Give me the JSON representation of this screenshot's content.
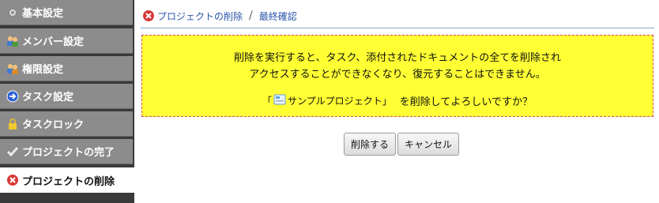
{
  "sidebar": {
    "items": [
      {
        "label": "基本設定",
        "icon": "settings-icon"
      },
      {
        "label": "メンバー設定",
        "icon": "members-icon"
      },
      {
        "label": "権限設定",
        "icon": "permissions-icon"
      },
      {
        "label": "タスク設定",
        "icon": "arrow-right-icon"
      },
      {
        "label": "タスクロック",
        "icon": "lock-icon"
      },
      {
        "label": "プロジェクトの完了",
        "icon": "checkmark-icon"
      },
      {
        "label": "プロジェクトの削除",
        "icon": "delete-icon"
      }
    ]
  },
  "breadcrumb": {
    "first": "プロジェクトの削除",
    "separator": "/",
    "second": "最終確認"
  },
  "warning": {
    "line1": "削除を実行すると、タスク、添付されたドキュメントの全てを削除され",
    "line2": "アクセスすることができなくなり、復元することはできません。",
    "quote_open": "「",
    "project_name": "サンプルプロジェクト",
    "quote_close": "」",
    "question": "を削除してよろしいですか？"
  },
  "buttons": {
    "delete": "削除する",
    "cancel": "キャンセル"
  },
  "colors": {
    "sidebar_item": "#8c8c8c",
    "warning_bg": "#ffff33",
    "warning_border": "#d4477a",
    "link": "#2a55aa"
  }
}
